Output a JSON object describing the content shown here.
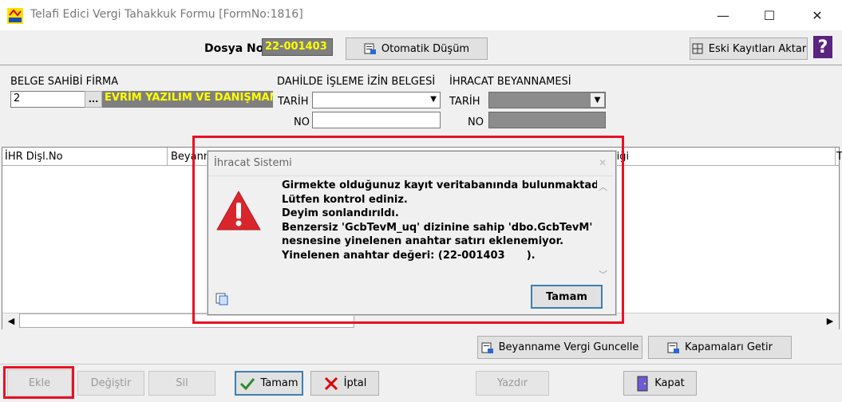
{
  "window": {
    "title": "Telafi Edici Vergi Tahakkuk Formu [FormNo:1816]",
    "minimize": "—",
    "maximize": "☐",
    "close": "✕"
  },
  "header": {
    "dosya_label": "Dosya No",
    "dosya_value": "22-001403",
    "otomatik_label": "Otomatik Düşüm",
    "eski_label": "Eski Kayıtları Aktar",
    "help_glyph": "?"
  },
  "belge": {
    "label": "BELGE SAHİBİ FİRMA",
    "code": "2",
    "dots": "...",
    "firm_name": "EVRİM YAZILIM VE DANIŞMAN"
  },
  "dahilde": {
    "label": "DAHİLDE İŞLEME İZİN BELGESİ",
    "tarih_label": "TARİH",
    "no_label": "NO"
  },
  "ihracat": {
    "label": "İHRACAT BEYANNAMESİ",
    "tarih_label": "TARİH",
    "no_label": "NO"
  },
  "grid": {
    "col1": "İHR Dişl.No",
    "col2": "Beyann",
    "col3": "liği",
    "col4": "T",
    "scroll_left": "◀",
    "scroll_right": "▶"
  },
  "mid_buttons": {
    "beyanname": "Beyanname Vergi Guncelle",
    "kapamalar": "Kapamaları Getir"
  },
  "bottom": {
    "ekle": "Ekle",
    "degistir": "Değiştir",
    "sil": "Sil",
    "tamam": "Tamam",
    "iptal": "İptal",
    "yazdir": "Yazdır",
    "kapat": "Kapat"
  },
  "dialog": {
    "title": "İhracat Sistemi",
    "close": "✕",
    "lines": [
      "Girmekte olduğunuz kayıt veritabanında bulunmaktadır.",
      "Lütfen kontrol ediniz.",
      "Deyim sonlandırıldı.",
      "Benzersiz 'GcbTevM_uq' dizinine sahip 'dbo.GcbTevM'",
      "nesnesine yinelenen anahtar satırı eklenemiyor.",
      "Yinelenen anahtar değeri: (22-001403      )."
    ],
    "ok_label": "Tamam",
    "scroll_up": "︿",
    "scroll_down": "﹀"
  },
  "colors": {
    "highlight_red": "#e81123",
    "yellow_text": "#ffff00",
    "warning_red": "#d9262c"
  }
}
